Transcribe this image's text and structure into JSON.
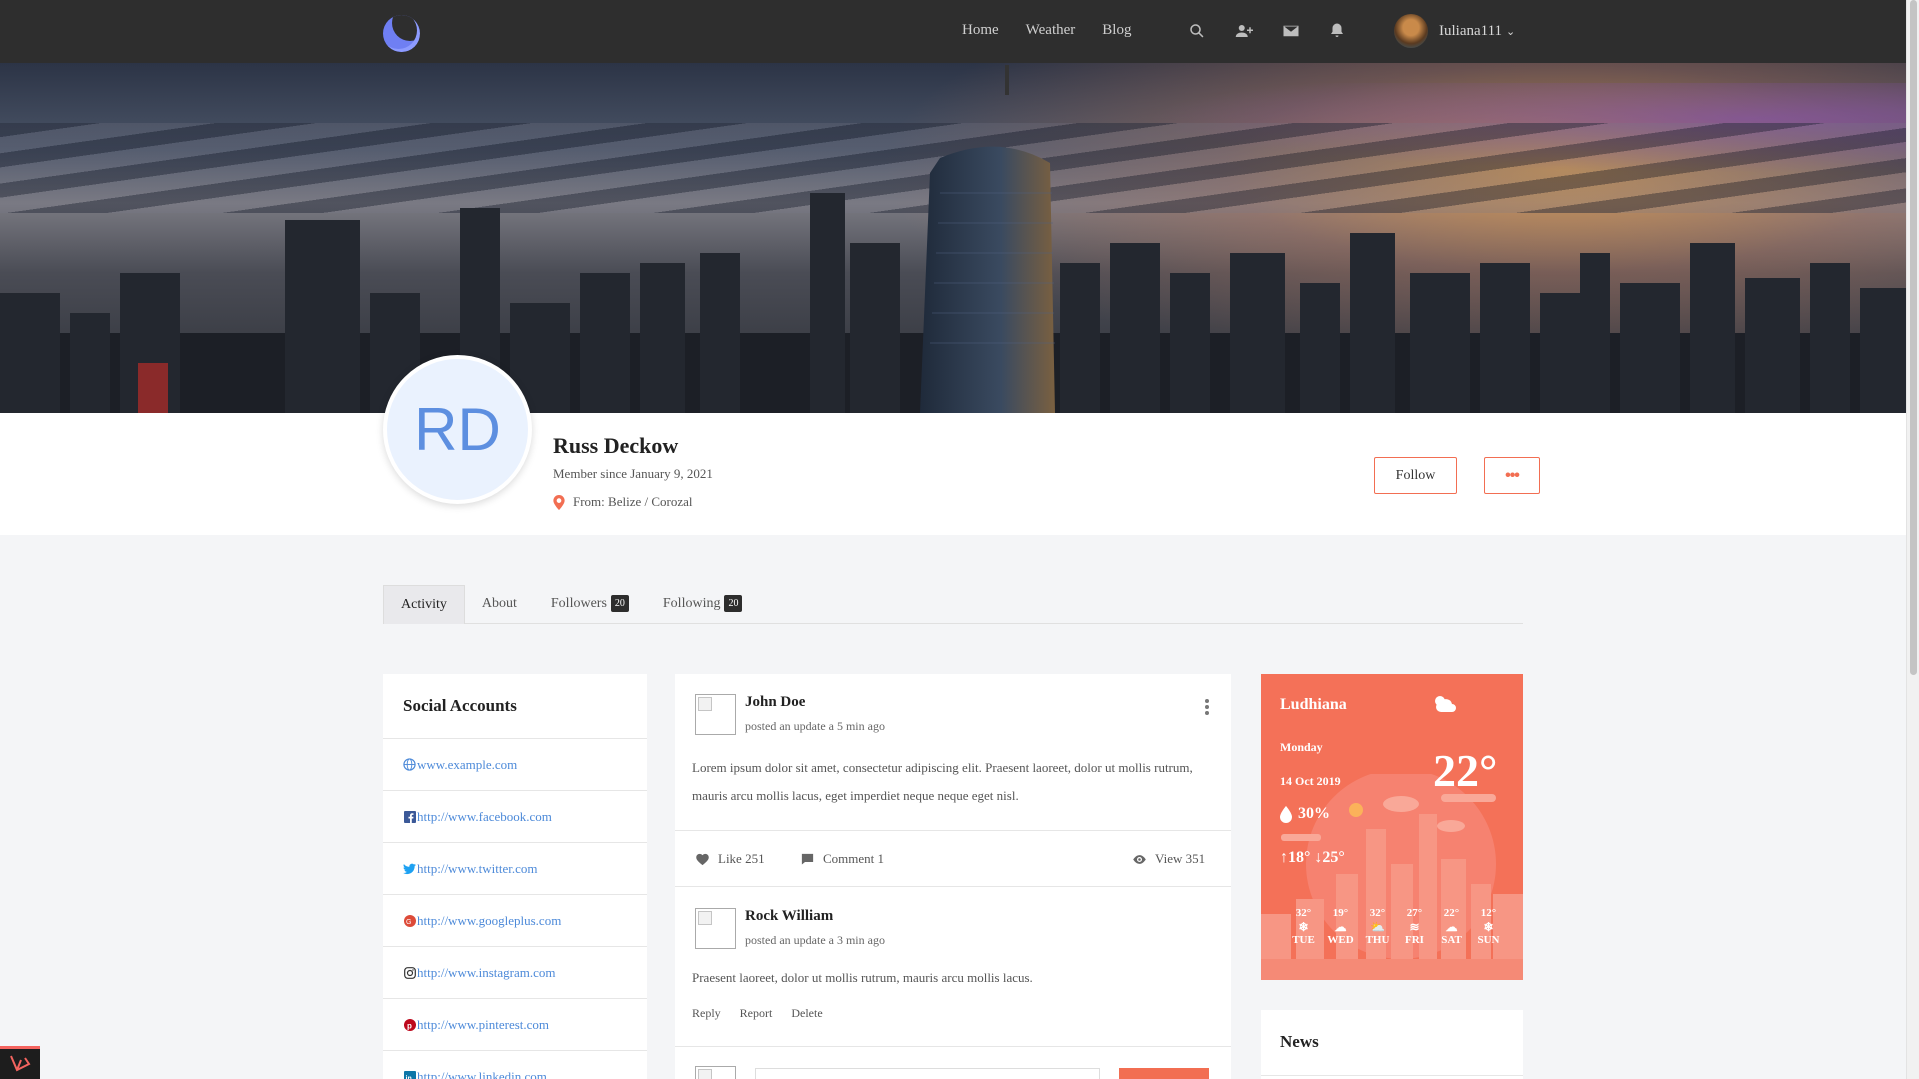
{
  "nav": {
    "links": [
      "Home",
      "Weather",
      "Blog"
    ],
    "username": "Iuliana111"
  },
  "profile": {
    "initials": "RD",
    "name": "Russ Deckow",
    "member_since": "Member since January 9, 2021",
    "from": "From: Belize / Corozal",
    "follow_label": "Follow",
    "more_label": "•••"
  },
  "tabs": [
    {
      "label": "Activity",
      "count": null,
      "active": true
    },
    {
      "label": "About",
      "count": null,
      "active": false
    },
    {
      "label": "Followers",
      "count": "20",
      "active": false
    },
    {
      "label": "Following",
      "count": "20",
      "active": false
    }
  ],
  "social": {
    "title": "Social Accounts",
    "items": [
      {
        "icon": "globe-icon",
        "url": "www.example.com",
        "color": "#4d8ad9"
      },
      {
        "icon": "facebook-icon",
        "url": "http://www.facebook.com",
        "color": "#3b5998"
      },
      {
        "icon": "twitter-icon",
        "url": "http://www.twitter.com",
        "color": "#1da1f2"
      },
      {
        "icon": "googleplus-icon",
        "url": "http://www.googleplus.com",
        "color": "#dd4b39"
      },
      {
        "icon": "instagram-icon",
        "url": "http://www.instagram.com",
        "color": "#333333"
      },
      {
        "icon": "pinterest-icon",
        "url": "http://www.pinterest.com",
        "color": "#bd081c"
      },
      {
        "icon": "linkedin-icon",
        "url": "http://www.linkedin.com",
        "color": "#0e76a8"
      }
    ]
  },
  "posts": [
    {
      "author": "John Doe",
      "meta": "posted an update a 5 min ago",
      "body": "Lorem ipsum dolor sit amet, consectetur adipiscing elit. Praesent laoreet, dolor ut mollis rutrum, mauris arcu mollis lacus, eget imperdiet neque neque eget nisl.",
      "like": "Like 251",
      "comment": "Comment 1",
      "view": "View 351"
    },
    {
      "author": "Rock William",
      "meta": "posted an update a 3 min ago",
      "body": "Praesent laoreet, dolor ut mollis rutrum, mauris arcu mollis lacus.",
      "actions": [
        "Reply",
        "Report",
        "Delete"
      ]
    }
  ],
  "weather": {
    "city": "Ludhiana",
    "day": "Monday",
    "date": "14 Oct 2019",
    "temp": "22°",
    "humidity": "30%",
    "high": "18°",
    "low": "25°",
    "bg_color": "#f47158",
    "forecast": [
      {
        "temp": "32°",
        "icon": "snow-icon",
        "day": "TUE"
      },
      {
        "temp": "19°",
        "icon": "cloud-rain-icon",
        "day": "WED"
      },
      {
        "temp": "32°",
        "icon": "cloud-sun-icon",
        "day": "THU"
      },
      {
        "temp": "27°",
        "icon": "wind-icon",
        "day": "FRI"
      },
      {
        "temp": "22°",
        "icon": "cloud-icon",
        "day": "SAT"
      },
      {
        "temp": "12°",
        "icon": "snow-icon",
        "day": "SUN"
      }
    ]
  },
  "news": {
    "title": "News"
  },
  "colors": {
    "accent": "#f26e52",
    "topbar": "#2e2e2e",
    "link": "#4d8ad9"
  }
}
